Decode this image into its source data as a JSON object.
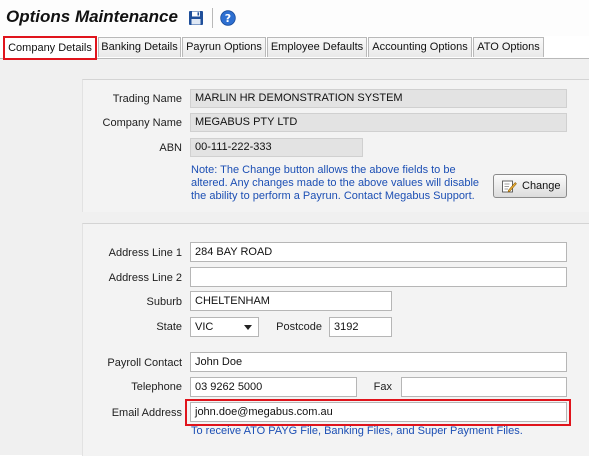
{
  "header": {
    "title": "Options Maintenance",
    "save_icon": "floppy-disk-icon",
    "help_icon": "help-icon"
  },
  "tabs": [
    {
      "label": "Company Details"
    },
    {
      "label": "Banking Details"
    },
    {
      "label": "Payrun Options"
    },
    {
      "label": "Employee Defaults"
    },
    {
      "label": "Accounting Options"
    },
    {
      "label": "ATO Options"
    }
  ],
  "company": {
    "trading_name_label": "Trading Name",
    "trading_name_value": "MARLIN HR DEMONSTRATION SYSTEM",
    "company_name_label": "Company Name",
    "company_name_value": "MEGABUS PTY LTD",
    "abn_label": "ABN",
    "abn_value": "00-111-222-333",
    "note": "Note: The Change button allows the above fields to be altered. Any changes made to the above values will disable the ability to perform a Payrun. Contact Megabus Support.",
    "change_button": "Change"
  },
  "address": {
    "line1_label": "Address Line 1",
    "line1_value": "284 BAY ROAD",
    "line2_label": "Address Line 2",
    "line2_value": "",
    "suburb_label": "Suburb",
    "suburb_value": "CHELTENHAM",
    "state_label": "State",
    "state_value": "VIC",
    "postcode_label": "Postcode",
    "postcode_value": "3192"
  },
  "contact": {
    "payroll_label": "Payroll Contact",
    "payroll_value": "John Doe",
    "telephone_label": "Telephone",
    "telephone_value": "03 9262 5000",
    "fax_label": "Fax",
    "fax_value": "",
    "email_label": "Email Address",
    "email_value": "john.doe@megabus.com.au",
    "email_note": "To receive ATO PAYG File, Banking Files, and Super Payment Files."
  },
  "colors": {
    "highlight": "#e0141c",
    "note_text": "#1c4fb4"
  }
}
